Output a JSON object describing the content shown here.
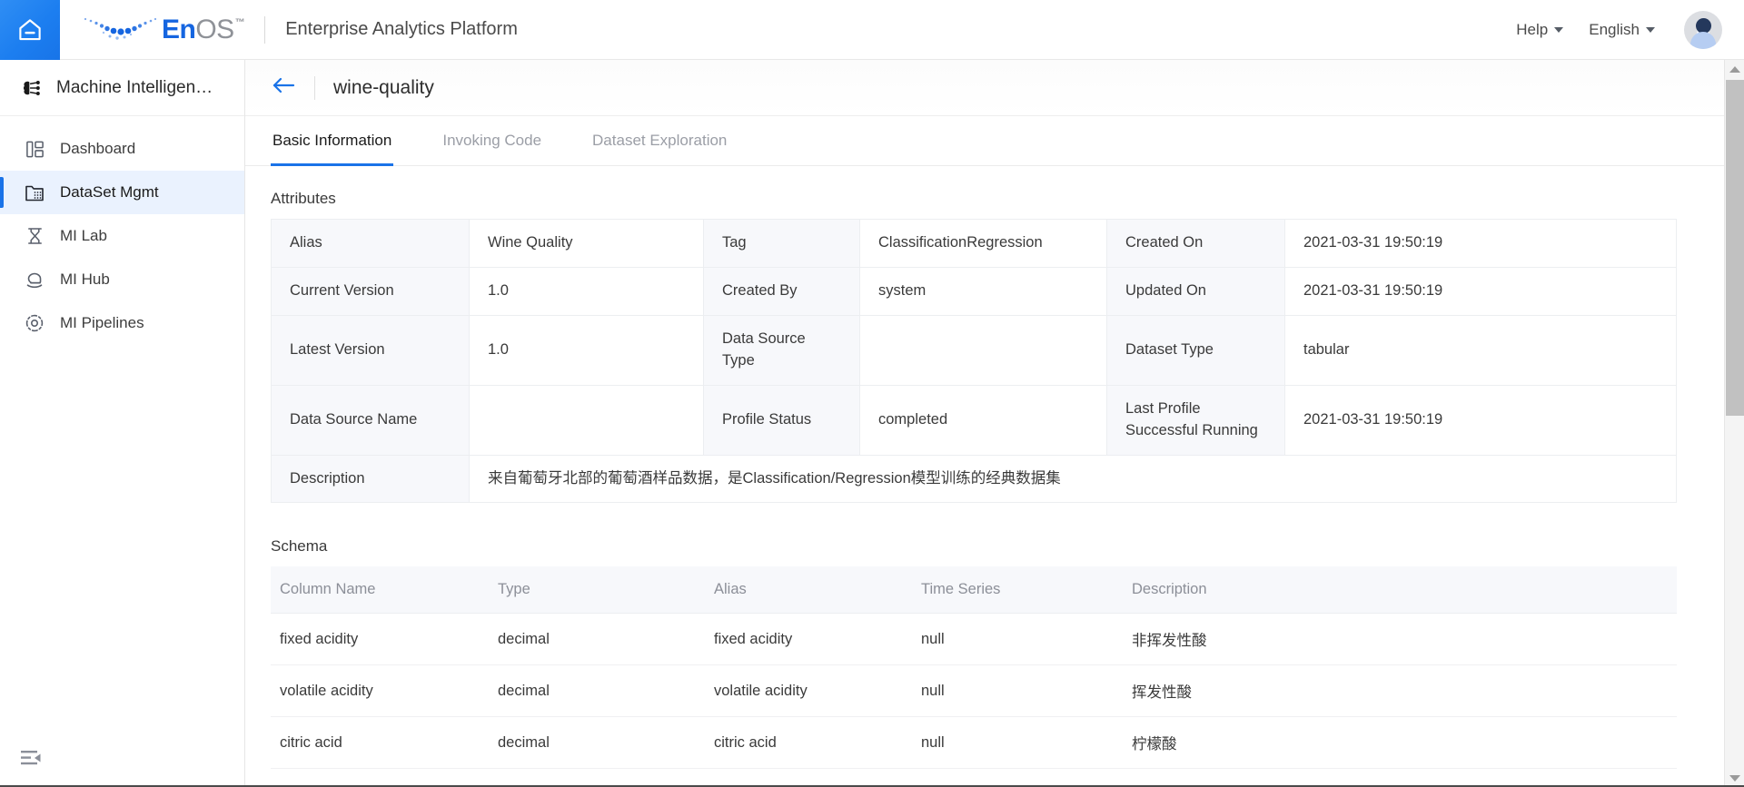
{
  "header": {
    "home_icon": "home-icon",
    "brand": {
      "en": "En",
      "os": "OS",
      "tm": "™"
    },
    "platform_title": "Enterprise Analytics Platform",
    "menus": [
      {
        "label": "Help",
        "name": "help-menu"
      },
      {
        "label": "English",
        "name": "language-menu"
      }
    ],
    "avatar_name": "user-avatar"
  },
  "sidebar": {
    "app_title": "Machine Intelligen…",
    "app_icon": "machine-intelligence-icon",
    "collapse_icon": "collapse-sidebar-icon",
    "items": [
      {
        "label": "Dashboard",
        "icon": "dashboard-icon",
        "active": false
      },
      {
        "label": "DataSet Mgmt",
        "icon": "dataset-icon",
        "active": true
      },
      {
        "label": "MI Lab",
        "icon": "flask-icon",
        "active": false
      },
      {
        "label": "MI Hub",
        "icon": "hub-icon",
        "active": false
      },
      {
        "label": "MI Pipelines",
        "icon": "pipelines-icon",
        "active": false
      }
    ]
  },
  "page": {
    "back_icon": "back-arrow-icon",
    "title": "wine-quality",
    "tabs": [
      {
        "label": "Basic Information",
        "active": true
      },
      {
        "label": "Invoking Code",
        "active": false
      },
      {
        "label": "Dataset Exploration",
        "active": false
      }
    ]
  },
  "attributes": {
    "section_label": "Attributes",
    "rows": [
      [
        {
          "type": "k",
          "text": "Alias"
        },
        {
          "type": "v",
          "text": "Wine Quality"
        },
        {
          "type": "k",
          "text": "Tag"
        },
        {
          "type": "v",
          "text": "ClassificationRegression"
        },
        {
          "type": "k",
          "text": "Created On"
        },
        {
          "type": "v",
          "text": "2021-03-31 19:50:19"
        }
      ],
      [
        {
          "type": "k",
          "text": "Current Version"
        },
        {
          "type": "v",
          "text": "1.0"
        },
        {
          "type": "k",
          "text": "Created By"
        },
        {
          "type": "v",
          "text": "system"
        },
        {
          "type": "k",
          "text": "Updated On"
        },
        {
          "type": "v",
          "text": "2021-03-31 19:50:19"
        }
      ],
      [
        {
          "type": "k",
          "text": "Latest Version"
        },
        {
          "type": "v",
          "text": "1.0"
        },
        {
          "type": "k",
          "text": "Data Source Type"
        },
        {
          "type": "v",
          "text": ""
        },
        {
          "type": "k",
          "text": "Dataset Type"
        },
        {
          "type": "v",
          "text": "tabular"
        }
      ],
      [
        {
          "type": "k",
          "text": "Data Source Name"
        },
        {
          "type": "v",
          "text": ""
        },
        {
          "type": "k",
          "text": "Profile Status"
        },
        {
          "type": "v",
          "text": "completed"
        },
        {
          "type": "k",
          "text": "Last Profile Successful Running"
        },
        {
          "type": "v",
          "text": "2021-03-31 19:50:19"
        }
      ]
    ],
    "description_key": "Description",
    "description_value": "来自葡萄牙北部的葡萄酒样品数据，是Classification/Regression模型训练的经典数据集"
  },
  "schema": {
    "section_label": "Schema",
    "columns": [
      "Column Name",
      "Type",
      "Alias",
      "Time Series",
      "Description"
    ],
    "rows": [
      [
        "fixed acidity",
        "decimal",
        "fixed acidity",
        "null",
        "非挥发性酸"
      ],
      [
        "volatile acidity",
        "decimal",
        "volatile acidity",
        "null",
        "挥发性酸"
      ],
      [
        "citric acid",
        "decimal",
        "citric acid",
        "null",
        "柠檬酸"
      ]
    ]
  },
  "scrollbar": {
    "up_icon": "scroll-up-arrow-icon",
    "down_icon": "scroll-down-arrow-icon",
    "thumb_name": "vertical-scrollbar-thumb"
  },
  "colors": {
    "accent": "#1a73e8",
    "brand_blue": "#1565e0",
    "active_bg": "#eaf2fe",
    "table_key_bg": "#f7f8fb"
  }
}
